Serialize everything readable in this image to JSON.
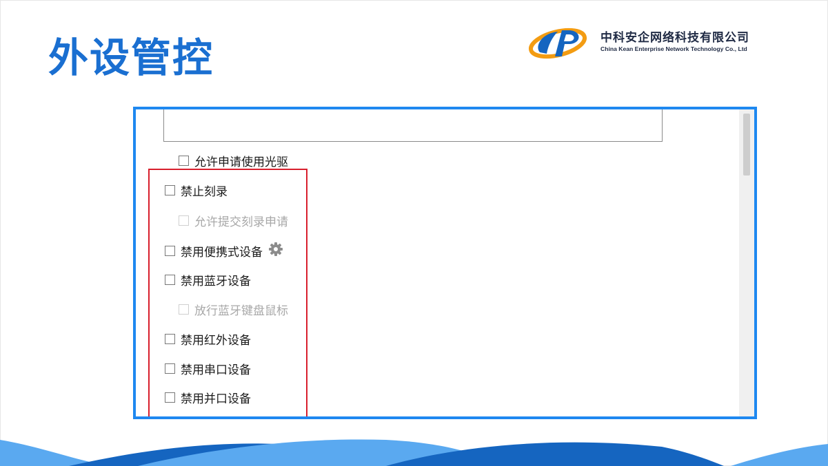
{
  "slide": {
    "title": "外设管控"
  },
  "logo": {
    "company_cn": "中科安企网络科技有限公司",
    "company_en": "China Kean Enterprise Network Technology Co., Ltd",
    "colors": {
      "blue": "#1565c0",
      "orange": "#f39c12"
    }
  },
  "settings": {
    "options": [
      {
        "label": "允许申请使用光驱",
        "checked": false,
        "disabled": false
      },
      {
        "label": "禁止刻录",
        "checked": false,
        "disabled": false
      },
      {
        "label": "允许提交刻录申请",
        "checked": false,
        "disabled": true
      },
      {
        "label": "禁用便携式设备",
        "checked": false,
        "disabled": false,
        "icon": "gear-icon"
      },
      {
        "label": "禁用蓝牙设备",
        "checked": false,
        "disabled": false
      },
      {
        "label": "放行蓝牙键盘鼠标",
        "checked": false,
        "disabled": true
      },
      {
        "label": "禁用红外设备",
        "checked": false,
        "disabled": false
      },
      {
        "label": "禁用串口设备",
        "checked": false,
        "disabled": false
      },
      {
        "label": "禁用并口设备",
        "checked": false,
        "disabled": false
      }
    ]
  },
  "colors": {
    "title": "#1a6fd1",
    "frame": "#1e88f0",
    "highlight": "#d81e2c",
    "wave_dark": "#1565c0",
    "wave_light": "#5aa9f0"
  }
}
